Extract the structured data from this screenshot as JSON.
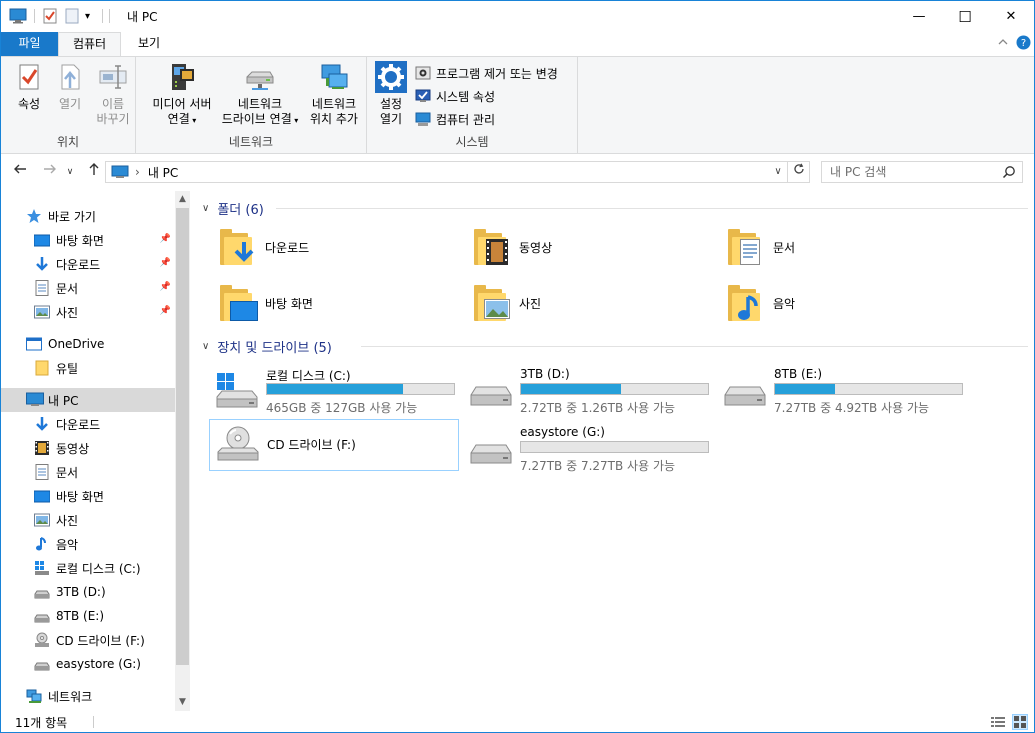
{
  "window": {
    "title": "내 PC",
    "controls": {
      "minimize": "—",
      "maximize": "☐",
      "close": "✕"
    }
  },
  "ribbon_tabs": [
    {
      "label": "파일"
    },
    {
      "label": "컴퓨터"
    },
    {
      "label": "보기"
    }
  ],
  "ribbon": {
    "location": {
      "label": "위치",
      "properties": "속성",
      "open": "열기",
      "rename_line1": "이름",
      "rename_line2": "바꾸기"
    },
    "network": {
      "label": "네트워크",
      "media_line1": "미디어 서버",
      "media_line2": "연결",
      "map_line1": "네트워크",
      "map_line2": "드라이브 연결",
      "add_line1": "네트워크",
      "add_line2": "위치 추가"
    },
    "system": {
      "label": "시스템",
      "settings_line1": "설정",
      "settings_line2": "열기",
      "uninstall": "프로그램 제거 또는 변경",
      "system_props": "시스템 속성",
      "manage": "컴퓨터 관리"
    }
  },
  "address": {
    "separator": "›",
    "path": "내 PC",
    "search_placeholder": "내 PC 검색"
  },
  "nav": {
    "quick_access": "바로 가기",
    "qa_items": [
      "바탕 화면",
      "다운로드",
      "문서",
      "사진"
    ],
    "onedrive": "OneDrive",
    "onedrive_items": [
      "유틸"
    ],
    "this_pc": "내 PC",
    "pc_items": [
      "다운로드",
      "동영상",
      "문서",
      "바탕 화면",
      "사진",
      "음악",
      "로컬 디스크 (C:)",
      "3TB (D:)",
      "8TB (E:)",
      "CD 드라이브 (F:)",
      "easystore (G:)"
    ],
    "network": "네트워크"
  },
  "folders_group": {
    "title": "폴더 (6)"
  },
  "folders": [
    {
      "name": "다운로드",
      "icon": "download"
    },
    {
      "name": "동영상",
      "icon": "video"
    },
    {
      "name": "문서",
      "icon": "document"
    },
    {
      "name": "바탕 화면",
      "icon": "desktop"
    },
    {
      "name": "사진",
      "icon": "pictures"
    },
    {
      "name": "음악",
      "icon": "music"
    }
  ],
  "drives_group": {
    "title": "장치 및 드라이브 (5)"
  },
  "drives": [
    {
      "name": "로컬 디스크 (C:)",
      "free": "465GB 중 127GB 사용 가능",
      "used_fraction": 0.727
    },
    {
      "name": "3TB (D:)",
      "free": "2.72TB 중 1.26TB 사용 가능",
      "used_fraction": 0.537
    },
    {
      "name": "8TB (E:)",
      "free": "7.27TB 중 4.92TB 사용 가능",
      "used_fraction": 0.323
    },
    {
      "name": "CD 드라이브 (F:)",
      "free": "",
      "used_fraction": null
    },
    {
      "name": "easystore (G:)",
      "free": "7.27TB 중 7.27TB 사용 가능",
      "used_fraction": 0.0
    }
  ],
  "status": {
    "item_count": "11개 항목"
  },
  "colors": {
    "accent": "#1979ca",
    "bar_fill": "#26a0da",
    "group_title": "#1e3287",
    "folder": "#ffd86c"
  }
}
